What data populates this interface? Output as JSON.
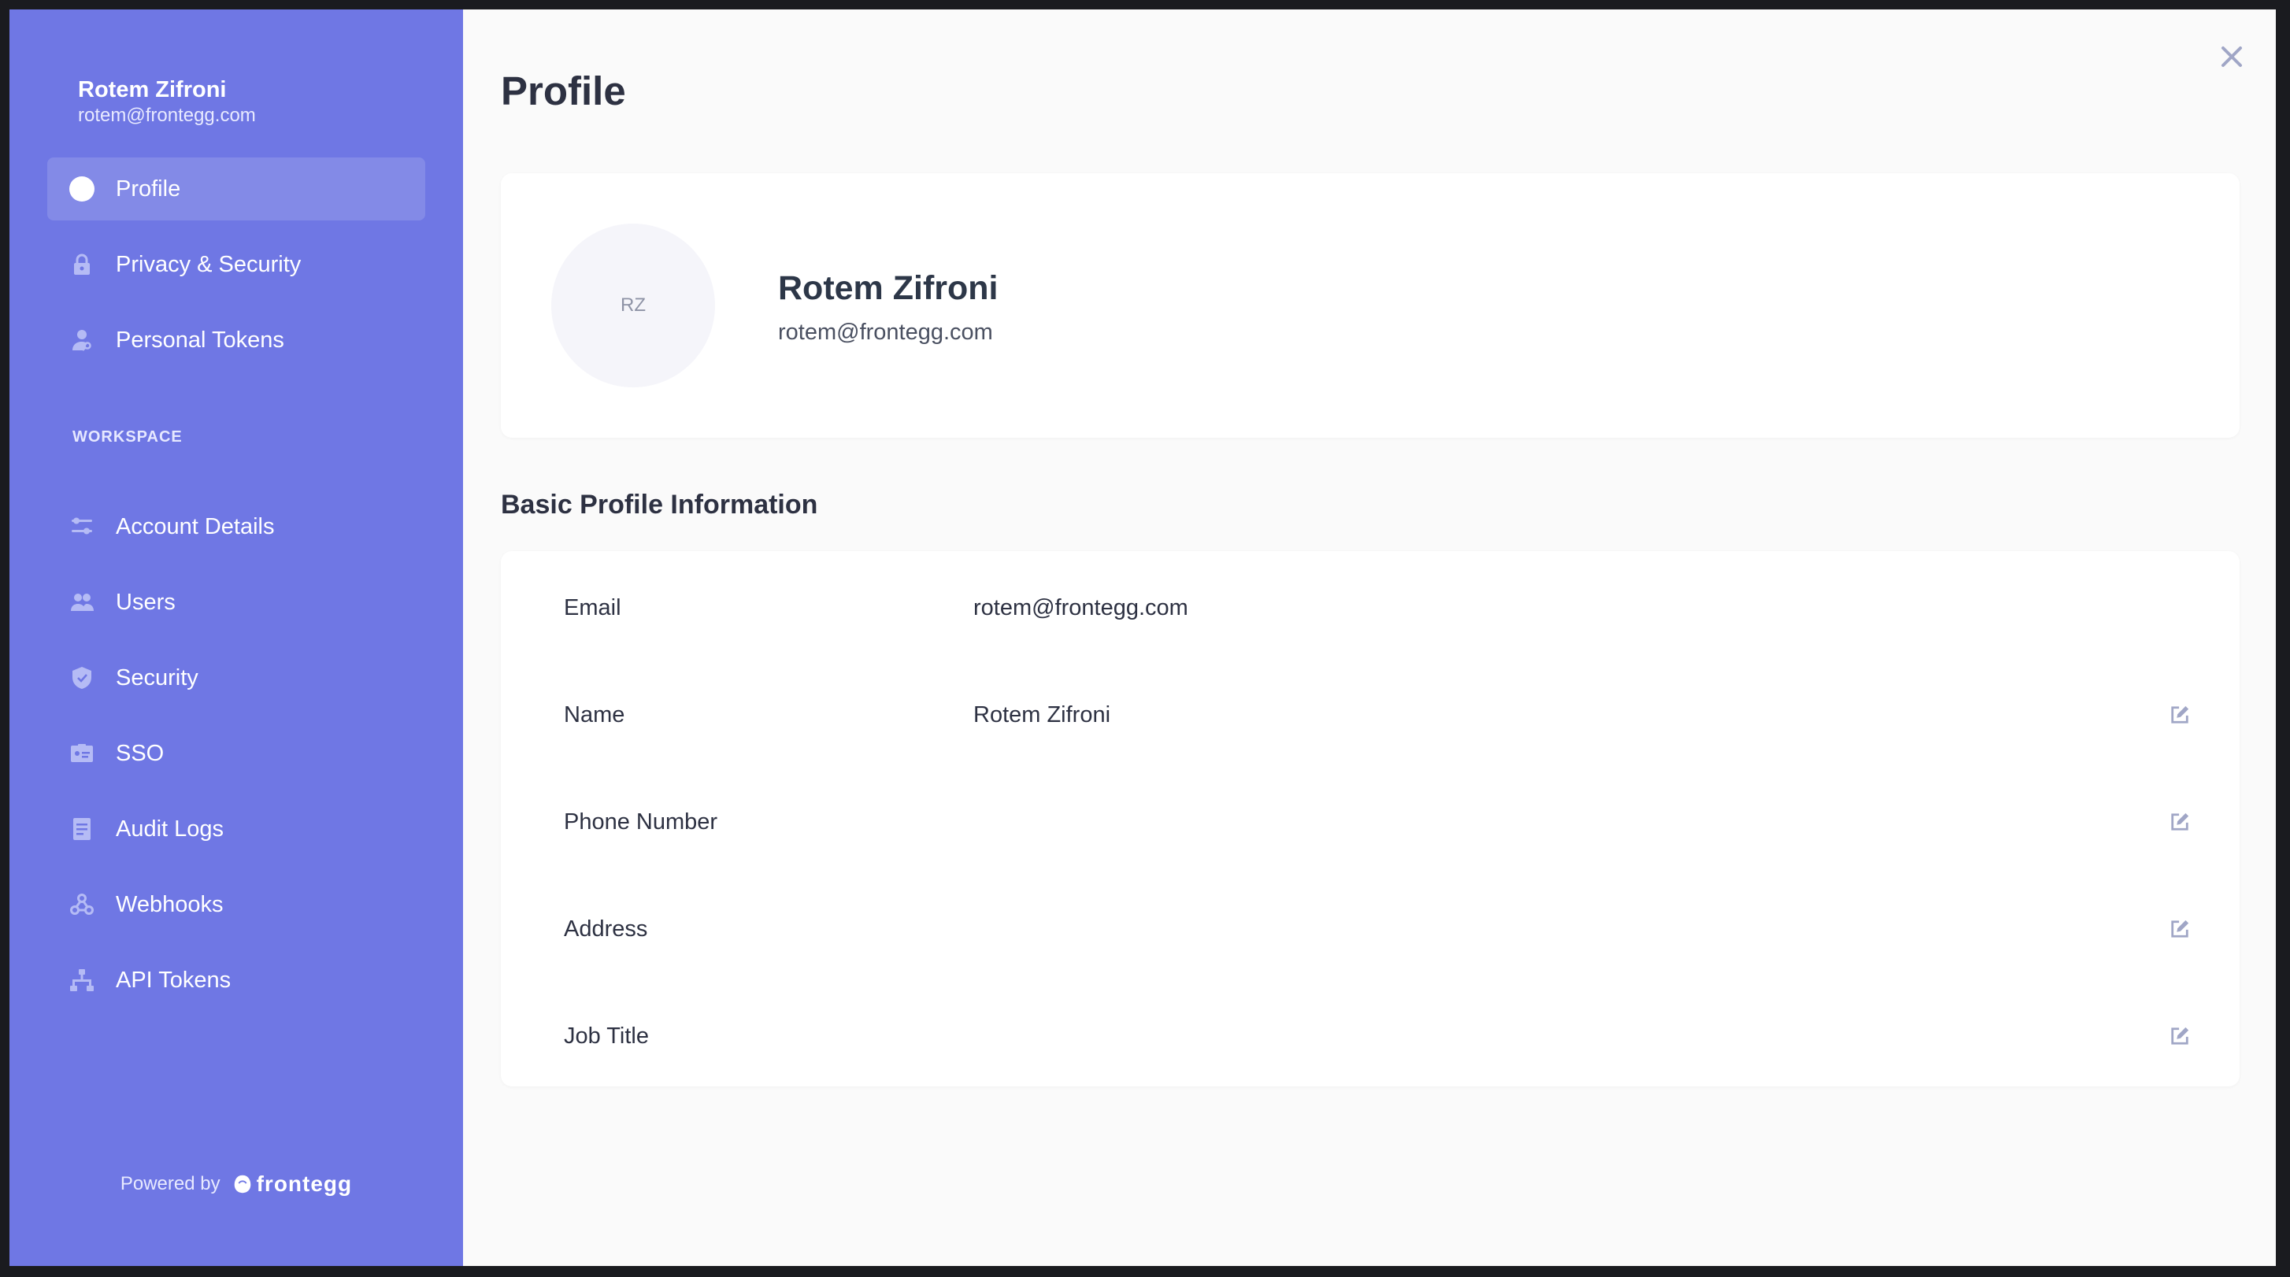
{
  "sidebar": {
    "user_name": "Rotem Zifroni",
    "user_email": "rotem@frontegg.com",
    "personal_items": [
      {
        "label": "Profile",
        "icon": "avatar-circle-icon",
        "active": true
      },
      {
        "label": "Privacy & Security",
        "icon": "lock-icon",
        "active": false
      },
      {
        "label": "Personal Tokens",
        "icon": "user-key-icon",
        "active": false
      }
    ],
    "workspace_label": "WORKSPACE",
    "workspace_items": [
      {
        "label": "Account Details",
        "icon": "sliders-icon"
      },
      {
        "label": "Users",
        "icon": "users-icon"
      },
      {
        "label": "Security",
        "icon": "shield-icon"
      },
      {
        "label": "SSO",
        "icon": "id-card-icon"
      },
      {
        "label": "Audit Logs",
        "icon": "document-icon"
      },
      {
        "label": "Webhooks",
        "icon": "webhook-icon"
      },
      {
        "label": "API Tokens",
        "icon": "network-icon"
      }
    ],
    "powered_by": "Powered by",
    "brand": "frontegg"
  },
  "main": {
    "title": "Profile",
    "close_icon": "close-icon",
    "profile_card": {
      "initials": "RZ",
      "name": "Rotem Zifroni",
      "email": "rotem@frontegg.com"
    },
    "section_title": "Basic Profile Information",
    "fields": [
      {
        "label": "Email",
        "value": "rotem@frontegg.com",
        "editable": false
      },
      {
        "label": "Name",
        "value": "Rotem Zifroni",
        "editable": true
      },
      {
        "label": "Phone Number",
        "value": "",
        "editable": true
      },
      {
        "label": "Address",
        "value": "",
        "editable": true
      },
      {
        "label": "Job Title",
        "value": "",
        "editable": true
      }
    ]
  },
  "colors": {
    "sidebar_bg": "#6f77e4",
    "icon_muted": "#b5bbf5",
    "edit_icon": "#a0a6c6",
    "page_bg": "#fafafa"
  }
}
